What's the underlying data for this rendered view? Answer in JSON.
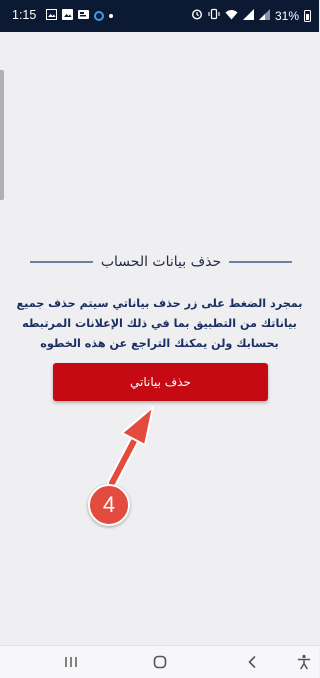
{
  "status_bar": {
    "time": "1:15",
    "battery": "31%",
    "left_icons": [
      "image-icon",
      "photo-icon",
      "card-icon",
      "circle-app-icon",
      "dot-icon"
    ],
    "right_icons": [
      "alarm-icon",
      "vibrate-icon",
      "wifi-icon",
      "signal-icon",
      "signal-icon",
      "battery-icon"
    ]
  },
  "content": {
    "heading": "حذف بيانات الحساب",
    "description": "بمجرد الضغط على زر حذف بياناتي سيتم حذف جميع بياناتك من التطبيق بما في ذلك الإعلانات المرتبطه بحسابك ولن يمكنك التراجع عن هذه الخطوه",
    "delete_button_label": "حذف بياناتي"
  },
  "annotation": {
    "step_number": "4"
  },
  "nav_bar": {
    "buttons": [
      "recents-icon",
      "home-icon",
      "back-icon",
      "accessibility-icon"
    ]
  },
  "colors": {
    "status_bar_bg": "#0c1933",
    "page_bg": "#efeff1",
    "button_red": "#c50a14",
    "text_blue": "#1a2f62",
    "annotation_red": "#e24b3e"
  }
}
